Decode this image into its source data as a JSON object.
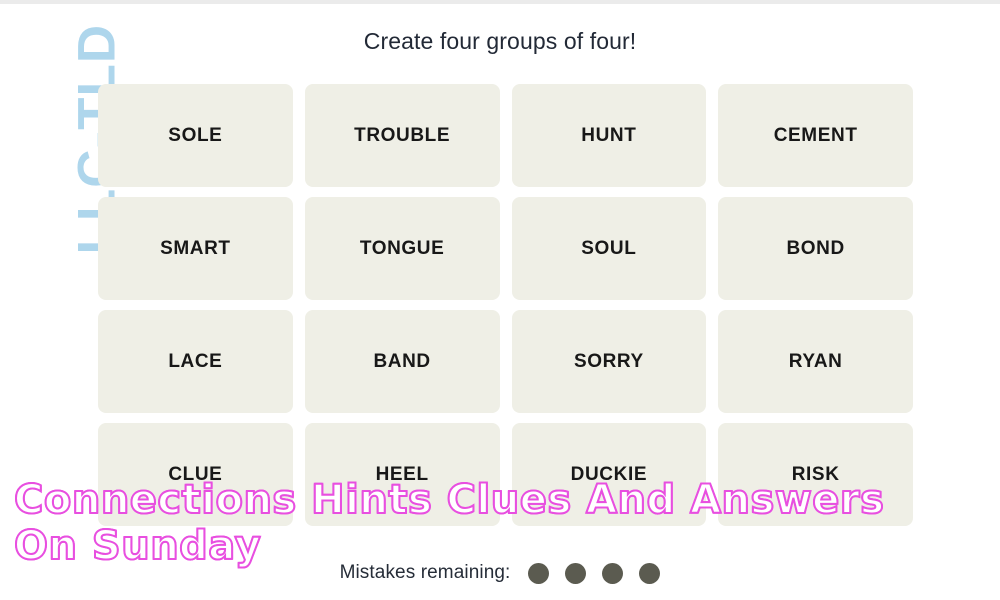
{
  "page": {
    "background_color": "#ffffff",
    "top_strip_color": "#ebebeb"
  },
  "watermark": {
    "text": "LLC-TLD",
    "color": "#aed6ec",
    "orientation": "rotated-90-ccw"
  },
  "game": {
    "prompt": "Create four groups of four!",
    "tile_color": "#efefe6",
    "tile_text_color": "#181818",
    "rows": [
      [
        "SOLE",
        "TROUBLE",
        "HUNT",
        "CEMENT"
      ],
      [
        "SMART",
        "TONGUE",
        "SOUL",
        "BOND"
      ],
      [
        "LACE",
        "BAND",
        "SORRY",
        "RYAN"
      ],
      [
        "CLUE",
        "HEEL",
        "DUCKIE",
        "RISK"
      ]
    ],
    "tiles": [
      "SOLE",
      "TROUBLE",
      "HUNT",
      "CEMENT",
      "SMART",
      "TONGUE",
      "SOUL",
      "BOND",
      "LACE",
      "BAND",
      "SORRY",
      "RYAN",
      "CLUE",
      "HEEL",
      "DUCKIE",
      "RISK"
    ],
    "status": {
      "label": "Mistakes remaining:",
      "mistakes_remaining": 4,
      "dot_color": "#5b5b50"
    }
  },
  "overlay": {
    "caption": "Connections Hints Clues And Answers On Sunday",
    "fill_color": "#ffffff",
    "outline_color": "#e84fe0"
  }
}
